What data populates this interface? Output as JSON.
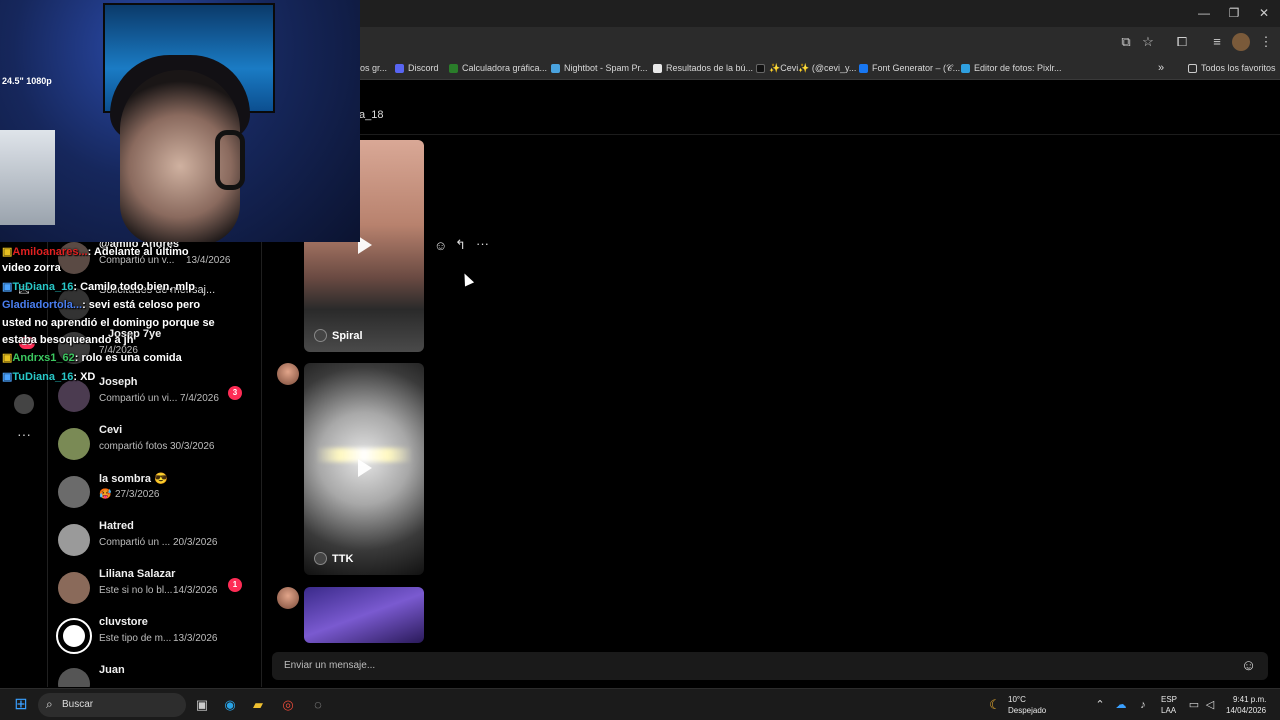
{
  "browser": {
    "window_controls": {
      "minimize": "—",
      "maximize": "❐",
      "close": "✕"
    },
    "bookmarks": [
      {
        "label": "os gr...",
        "color": "#888888"
      },
      {
        "label": "Discord",
        "color": "#5865F2"
      },
      {
        "label": "Calculadora gráfica...",
        "color": "#2a7d2a"
      },
      {
        "label": "Nightbot - Spam Pr...",
        "color": "#4aa3df"
      },
      {
        "label": "Resultados de la bú...",
        "color": "#e8e8e8"
      },
      {
        "label": "✨Cevi✨ (@cevi_y...",
        "color": "#111111"
      },
      {
        "label": "Font Generator – (𝒞...",
        "color": "#1877F2"
      },
      {
        "label": "Editor de fotos: Pixlr...",
        "color": "#2fa0e0"
      }
    ],
    "all_favorites": "Todos los favoritos",
    "more_bookmarks": "»"
  },
  "webcam": {
    "overlay_text": "24.5\" 1080p"
  },
  "conversation_header": {
    "partial_name": "a_18"
  },
  "conversations": [
    {
      "name": "@amilo Andres",
      "preview": "Compartió un v...",
      "date": "13/4/2026",
      "avatar_color": "#5a4a44"
    },
    {
      "name": "Solicitudes de mensaj...",
      "preview": "",
      "date": "",
      "avatar_color": "#333333"
    },
    {
      "name": "Josep 7ye",
      "preview": "",
      "date": "7/4/2026",
      "avatar_color": "#3b3b3b"
    },
    {
      "name": "Joseph",
      "preview": "Compartió un vi...",
      "date": "7/4/2026",
      "badge": "3",
      "avatar_color": "#4b3b50"
    },
    {
      "name": "Cevi",
      "preview": "compartió fotos",
      "date": "30/3/2026",
      "avatar_color": "#7a8a55"
    },
    {
      "name": "la sombra 😎",
      "preview": "🥵",
      "date": "27/3/2026",
      "avatar_color": "#6b6b6b"
    },
    {
      "name": "Hatred",
      "preview": "Compartió un ...",
      "date": "20/3/2026",
      "avatar_color": "#9a9a9a"
    },
    {
      "name": "Liliana Salazar",
      "preview": "Este si no lo bl...",
      "date": "14/3/2026",
      "badge": "1",
      "avatar_color": "#8a6a5a"
    },
    {
      "name": "cluvstore",
      "preview": "Este tipo de m...",
      "date": "13/3/2026",
      "avatar_color": "#ffffff"
    },
    {
      "name": "Juan",
      "preview": "",
      "date": "",
      "avatar_color": "#555555"
    }
  ],
  "nav_badge": "10",
  "nav_more": "···",
  "chat_overlay": [
    {
      "user": "Amiloanares...",
      "user_color": "#e02020",
      "text": ": Adelante al último"
    },
    {
      "user": "",
      "user_color": "#ffffff",
      "text": "video zorra"
    },
    {
      "user": "TuDiana_16",
      "user_color": "#28c8c8",
      "text": ": Camilo todo bien, mlp"
    },
    {
      "user": "Gladiadortola...",
      "user_color": "#4a7ef0",
      "text": ": sevi está celoso pero"
    },
    {
      "user": "",
      "user_color": "#ffffff",
      "text": "usted no aprendió el domingo porque se"
    },
    {
      "user": "",
      "user_color": "#ffffff",
      "text": "estaba besoqueando a jh"
    },
    {
      "user": "Andrxs1_62",
      "user_color": "#3cc860",
      "text": ": rolo es una comida"
    },
    {
      "user": "TuDiana_16",
      "user_color": "#28c8c8",
      "text": ": XD"
    }
  ],
  "videos": [
    {
      "label": "Spiral"
    },
    {
      "label": "TTK"
    },
    {
      "label": ""
    }
  ],
  "message_actions": {
    "react": "☺",
    "reply": "↰",
    "more": "···"
  },
  "message_input": {
    "placeholder": "Enviar un mensaje...",
    "emoji_icon": "☺"
  },
  "taskbar": {
    "search_label": "Buscar",
    "weather_temp": "10°C",
    "weather_desc": "Despejado",
    "lang_line1": "ESP",
    "lang_line2": "LAA",
    "time": "9:41 p.m.",
    "date": "14/04/2026"
  }
}
